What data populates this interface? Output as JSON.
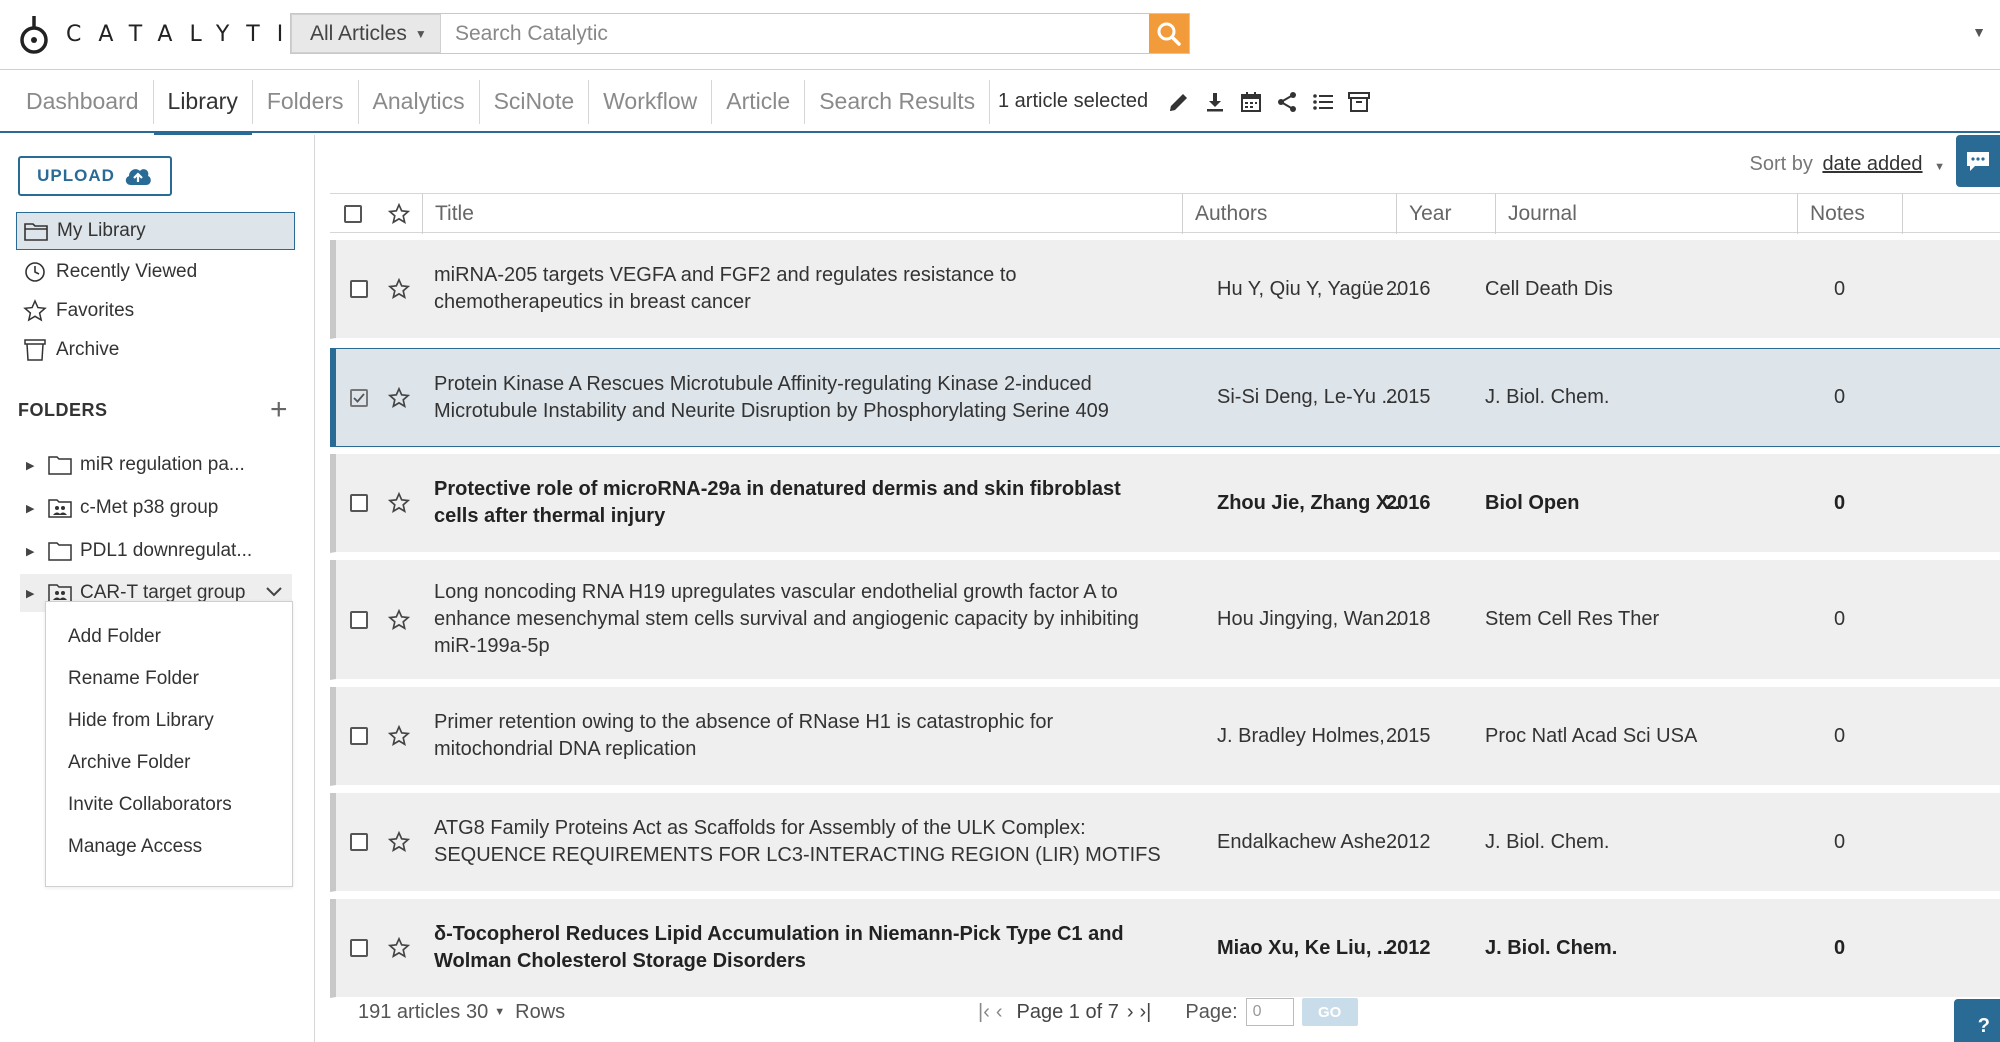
{
  "app": {
    "logo_text": "CATALYTIC"
  },
  "search": {
    "scope": "All Articles",
    "placeholder": "Search Catalytic"
  },
  "nav": {
    "tabs": [
      {
        "label": "Dashboard"
      },
      {
        "label": "Library"
      },
      {
        "label": "Folders"
      },
      {
        "label": "Analytics"
      },
      {
        "label": "SciNote"
      },
      {
        "label": "Workflow"
      },
      {
        "label": "Article"
      },
      {
        "label": "Search Results"
      }
    ],
    "active_tab": "Library",
    "selection_text": "1 article selected"
  },
  "sidebar": {
    "upload_label": "UPLOAD",
    "library_items": [
      {
        "label": "My Library",
        "icon": "folder-open-icon"
      },
      {
        "label": "Recently Viewed",
        "icon": "clock-icon"
      },
      {
        "label": "Favorites",
        "icon": "star-icon"
      },
      {
        "label": "Archive",
        "icon": "archive-bin-icon"
      }
    ],
    "folders_header": "FOLDERS",
    "folders": [
      {
        "label": "miR regulation pa...",
        "icon": "folder-icon"
      },
      {
        "label": "c-Met p38 group",
        "icon": "shared-folder-icon"
      },
      {
        "label": "PDL1 downregulat...",
        "icon": "folder-icon"
      },
      {
        "label": "CAR-T target group",
        "icon": "shared-folder-icon"
      }
    ],
    "context_menu": [
      {
        "label": "Add Folder"
      },
      {
        "label": "Rename Folder"
      },
      {
        "label": "Hide from Library"
      },
      {
        "label": "Archive Folder"
      },
      {
        "label": "Invite Collaborators"
      },
      {
        "label": "Manage Access"
      }
    ]
  },
  "main": {
    "sort_label": "Sort by",
    "sort_value": "date added",
    "columns": {
      "title": "Title",
      "authors": "Authors",
      "year": "Year",
      "journal": "Journal",
      "notes": "Notes"
    },
    "rows": [
      {
        "title": "miRNA-205 targets VEGFA and FGF2 and regulates resistance to chemotherapeutics in breast cancer",
        "authors": "Hu Y, Qiu Y, Yagüe ...",
        "year": "2016",
        "journal": "Cell Death Dis",
        "notes": "0"
      },
      {
        "title": "Protein Kinase A Rescues Microtubule Affinity-regulating Kinase 2-induced Microtubule Instability and Neurite Disruption by Phosphorylating Serine 409",
        "authors": "Si-Si Deng, Le-Yu ...",
        "year": "2015",
        "journal": "J. Biol. Chem.",
        "notes": "0"
      },
      {
        "title": "Protective role of microRNA-29a in denatured dermis and skin fibroblast cells after thermal injury",
        "authors": "Zhou Jie, Zhang X...",
        "year": "2016",
        "journal": "Biol Open",
        "notes": "0"
      },
      {
        "title": "Long noncoding RNA H19 upregulates vascular endothelial growth factor A to enhance mesenchymal stem cells survival and angiogenic capacity by inhibiting miR-199a-5p",
        "authors": "Hou Jingying, Wan...",
        "year": "2018",
        "journal": "Stem Cell Res Ther",
        "notes": "0"
      },
      {
        "title": "Primer retention owing to the absence of RNase H1 is catastrophic for mitochondrial DNA replication",
        "authors": "J. Bradley Holmes, ...",
        "year": "2015",
        "journal": "Proc Natl Acad Sci USA",
        "notes": "0"
      },
      {
        "title": "ATG8 Family Proteins Act as Scaffolds for Assembly of the ULK Complex: SEQUENCE REQUIREMENTS FOR LC3-INTERACTING REGION (LIR) MOTIFS",
        "authors": "Endalkachew Ashe...",
        "year": "2012",
        "journal": "J. Biol. Chem.",
        "notes": "0"
      },
      {
        "title": "δ-Tocopherol Reduces Lipid Accumulation in Niemann-Pick Type C1 and Wolman Cholesterol Storage Disorders",
        "authors": "Miao Xu, Ke Liu, ...",
        "year": "2012",
        "journal": "J. Biol. Chem.",
        "notes": "0"
      }
    ]
  },
  "footer": {
    "count": "191 articles",
    "rows_value": "30",
    "rows_label": "Rows",
    "page_text": "Page 1 of 7",
    "page_label": "Page:",
    "page_input_value": "0",
    "go_label": "GO"
  },
  "help_label": "?",
  "colors": {
    "accent": "#2a6b96",
    "search_button": "#f29b3b",
    "selected_row": "#dde4ea",
    "row_bg": "#efefef"
  }
}
